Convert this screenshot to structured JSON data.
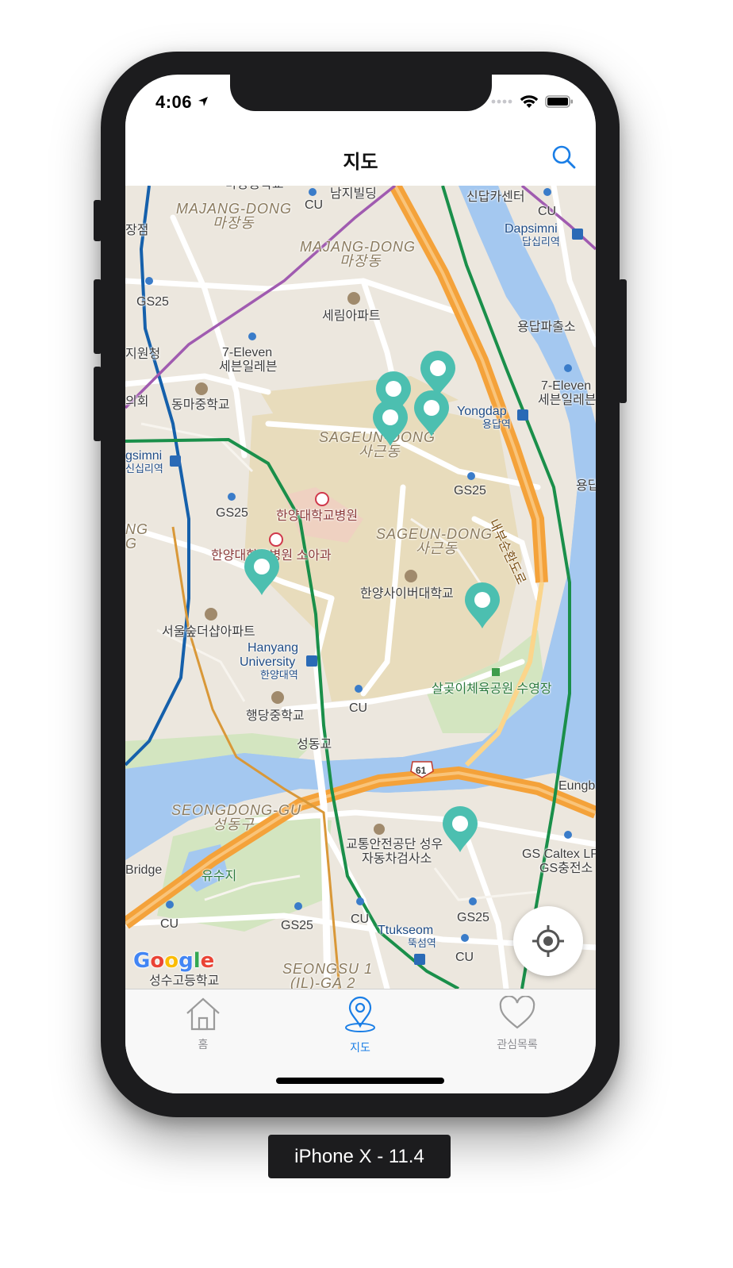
{
  "status_bar": {
    "time": "4:06",
    "location_icon": "location-arrow-icon",
    "icons": [
      "signal-dots-icon",
      "wifi-icon",
      "battery-icon"
    ]
  },
  "nav": {
    "title": "지도",
    "search_icon": "search-icon"
  },
  "map": {
    "labels": {
      "majang_school": "마장중학교",
      "namji": "남지빌딩",
      "cu1": "CU",
      "majang_dong_en1": "MAJANG-DONG",
      "majang_dong_ko1": "마장동",
      "sindap_center": "신답카센터",
      "cu2": "CU",
      "dapsimni_en": "Dapsimni",
      "dapsimni_ko": "답십리역",
      "jangjeom": "장점",
      "majang_dong_en2": "MAJANG-DONG",
      "majang_dong_ko2": "마장동",
      "gs25_1": "GS25",
      "serim": "세림아파트",
      "yongdap_police": "용답파출소",
      "jiwonchung": "지원청",
      "seven_en1": "7-Eleven",
      "seven_ko1": "세븐일레븐",
      "seven_en2": "7-Eleven",
      "seven_ko2": "세븐일레븐",
      "hoe": "의회",
      "dongma_school": "동마중학교",
      "yongdap_en": "Yongdap",
      "yongdap_ko": "용답역",
      "sageun_en1": "SAGEUN-DONG",
      "sageun_ko1": "사근동",
      "sinsimni_en": "gsimni",
      "sinsimni_ko": "신십리역",
      "gs25_2": "GS25",
      "yongdap_right": "용답",
      "gs25_3": "GS25",
      "hanyang_hospital": "한양대학교병원",
      "sageun_en2": "SAGEUN-DONG",
      "sageun_ko2": "사근동",
      "ring_road": "내부순환도로",
      "ng": "NG",
      "g": "G",
      "hanyang_kids": "한양대학교병원 소아과",
      "hanyang_cyber": "한양사이버대학교",
      "seoul_sup": "서울숲더샵아파트",
      "hanyang_univ_en1": "Hanyang",
      "hanyang_univ_en2": "University",
      "hanyang_univ_ko": "한양대역",
      "salgoji": "살곶이체육공원 수영장",
      "cu3": "CU",
      "haengdang_school": "행당중학교",
      "seongdong_bridge": "성동교",
      "route_61": "61",
      "eungb": "Eungb",
      "seongdong_gu_en": "SEONGDONG-GU",
      "seongdong_gu_ko": "성동구",
      "traffic_safety1": "교통안전공단 성우",
      "traffic_safety2": "자동차검사소",
      "gs_caltex1": "GS Caltex LP",
      "gs_caltex2": "GS충전소",
      "bridge": "Bridge",
      "yusuji": "유수지",
      "cu4": "CU",
      "gs25_4": "GS25",
      "cu5": "CU",
      "gs25_5": "GS25",
      "ttukseom_en": "Ttukseom",
      "ttukseom_ko": "뚝섬역",
      "cu6": "CU",
      "seongsu_en": "SEONGSU 1",
      "seongsu_en2": "(IL)-GA 2",
      "seongsu_ko": "성수고등학교",
      "google": "Google"
    },
    "pin_color": "#4cbfb0",
    "pin_icon": "map-pin-icon",
    "locate_icon": "crosshair-location-icon"
  },
  "tabs": [
    {
      "label": "홈",
      "icon": "home-icon",
      "active": false
    },
    {
      "label": "지도",
      "icon": "map-pin-icon",
      "active": true
    },
    {
      "label": "관심목록",
      "icon": "heart-icon",
      "active": false
    }
  ],
  "device_label": "iPhone X - 11.4",
  "colors": {
    "accent": "#1a7ee6",
    "inactive": "#8e8e93",
    "river": "#a4c8f0",
    "park": "#cde3b9",
    "campus": "#e9dcb8",
    "highway": "#f4a23a"
  }
}
